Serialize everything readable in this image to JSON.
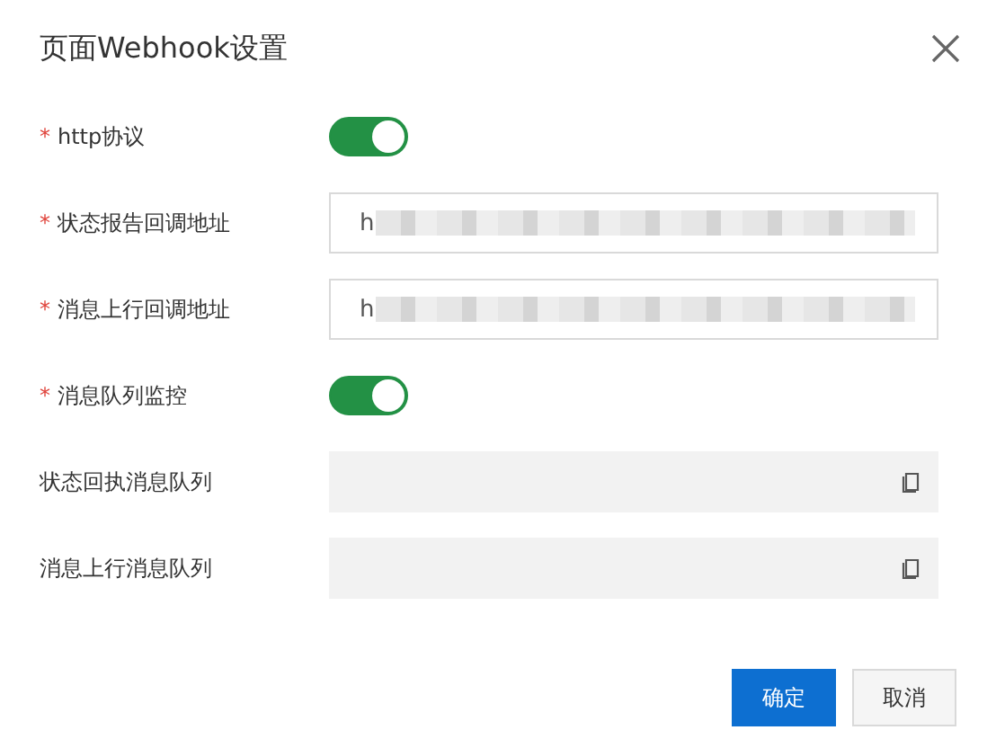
{
  "dialog": {
    "title": "页面Webhook设置"
  },
  "fields": [
    {
      "label": "http协议",
      "required_mark": "*",
      "kind": "switch",
      "on": true
    },
    {
      "label": "状态报告回调地址",
      "required_mark": "*",
      "kind": "input",
      "value": "h"
    },
    {
      "label": "消息上行回调地址",
      "required_mark": "*",
      "kind": "input",
      "value": "h"
    },
    {
      "label": "消息队列监控",
      "required_mark": "*",
      "kind": "switch",
      "on": true
    },
    {
      "label": "状态回执消息队列",
      "kind": "readonly"
    },
    {
      "label": "消息上行消息队列",
      "kind": "readonly"
    }
  ],
  "buttons": [
    {
      "label": "确定",
      "kind": "primary"
    },
    {
      "label": "取消",
      "kind": "secondary"
    }
  ]
}
